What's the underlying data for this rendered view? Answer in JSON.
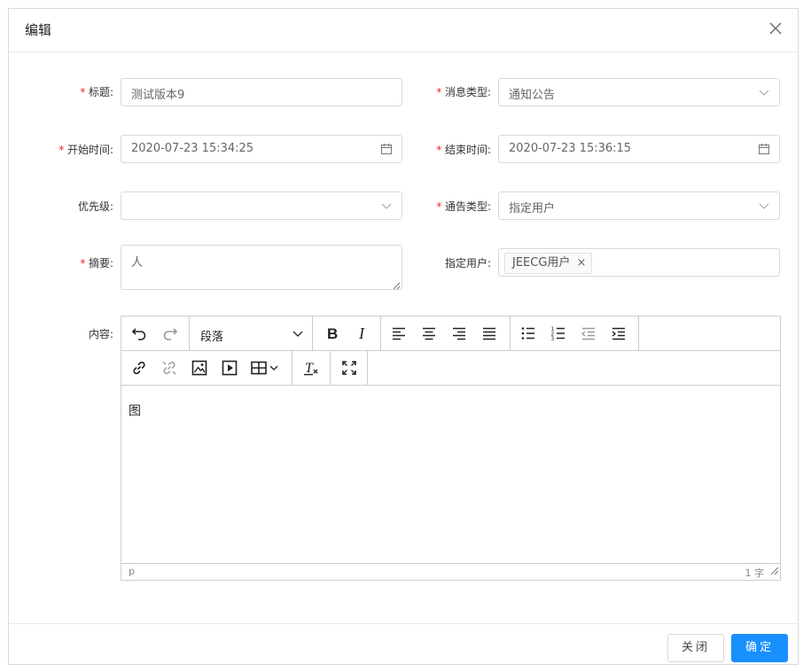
{
  "dialog": {
    "title": "编辑",
    "close_icon": "close-icon"
  },
  "form": {
    "required_mark": "*",
    "title": {
      "label": "标题:",
      "value": "测试版本9"
    },
    "msg_type": {
      "label": "消息类型:",
      "value": "通知公告"
    },
    "start_time": {
      "label": "开始时间:",
      "value": "2020-07-23 15:34:25"
    },
    "end_time": {
      "label": "结束时间:",
      "value": "2020-07-23 15:36:15"
    },
    "priority": {
      "label": "优先级:",
      "value": ""
    },
    "notice_type": {
      "label": "通告类型:",
      "value": "指定用户"
    },
    "summary": {
      "label": "摘要:",
      "value": "人"
    },
    "users": {
      "label": "指定用户:",
      "tag": "JEECG用户",
      "tag_remove": "×"
    },
    "content": {
      "label": "内容:"
    }
  },
  "editor": {
    "block_format": "段落",
    "body_text": "图",
    "status_path": "p",
    "word_count": "1 字"
  },
  "footer": {
    "close_label": "关闭",
    "ok_label": "确定"
  },
  "colors": {
    "primary": "#1890ff",
    "required": "#f5222d",
    "border": "#d9d9d9"
  }
}
